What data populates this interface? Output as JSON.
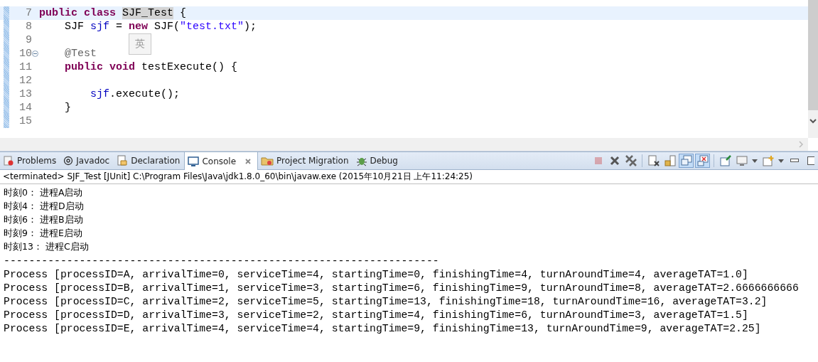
{
  "editor": {
    "lines": [
      {
        "number": "7",
        "current": true,
        "folding": false,
        "tokens": [
          {
            "kind": "keyword",
            "text": "public "
          },
          {
            "kind": "keyword",
            "text": "class "
          },
          {
            "kind": "occurrence",
            "text": "SJF_Test"
          },
          {
            "kind": "plain",
            "text": " {"
          }
        ]
      },
      {
        "number": "8",
        "current": false,
        "folding": false,
        "tokens": [
          {
            "kind": "plain",
            "text": "    SJF "
          },
          {
            "kind": "field",
            "text": "sjf"
          },
          {
            "kind": "plain",
            "text": " = "
          },
          {
            "kind": "keyword",
            "text": "new"
          },
          {
            "kind": "plain",
            "text": " SJF("
          },
          {
            "kind": "string",
            "text": "\"test.txt\""
          },
          {
            "kind": "plain",
            "text": ");"
          }
        ]
      },
      {
        "number": "9",
        "current": false,
        "folding": false
      },
      {
        "number": "10",
        "current": false,
        "folding": true,
        "tokens": [
          {
            "kind": "annotation",
            "text": "    @Test"
          }
        ]
      },
      {
        "number": "11",
        "current": false,
        "folding": false,
        "tokens": [
          {
            "kind": "keyword",
            "text": "    public "
          },
          {
            "kind": "keyword",
            "text": "void "
          },
          {
            "kind": "plain",
            "text": "testExecute() {"
          }
        ]
      },
      {
        "number": "12",
        "current": false,
        "folding": false
      },
      {
        "number": "13",
        "current": false,
        "folding": false,
        "tokens": [
          {
            "kind": "field",
            "text": "        sjf"
          },
          {
            "kind": "plain",
            "text": ".execute();"
          }
        ]
      },
      {
        "number": "14",
        "current": false,
        "folding": false,
        "tokens": [
          {
            "kind": "plain",
            "text": "    }"
          }
        ]
      },
      {
        "number": "15",
        "current": false,
        "folding": false
      }
    ],
    "ime_indicator": "英"
  },
  "tabs": [
    {
      "label": "Problems",
      "selected": false,
      "closable": false
    },
    {
      "label": "Javadoc",
      "selected": false,
      "closable": false
    },
    {
      "label": "Declaration",
      "selected": false,
      "closable": false
    },
    {
      "label": "Console",
      "selected": true,
      "closable": true
    },
    {
      "label": "Project Migration",
      "selected": false,
      "closable": false
    },
    {
      "label": "Debug",
      "selected": false,
      "closable": false
    }
  ],
  "toolbar": [
    {
      "kind": "terminate",
      "pressed": false,
      "disabled": true
    },
    {
      "kind": "remove",
      "pressed": false,
      "disabled": false
    },
    {
      "kind": "remove-all",
      "pressed": false,
      "disabled": false
    },
    {
      "kind": "separator"
    },
    {
      "kind": "clear",
      "pressed": false,
      "disabled": false
    },
    {
      "kind": "scroll-lock",
      "pressed": false,
      "disabled": false
    },
    {
      "kind": "show-out",
      "pressed": true,
      "disabled": false
    },
    {
      "kind": "show-err",
      "pressed": true,
      "disabled": false
    },
    {
      "kind": "separator"
    },
    {
      "kind": "pin",
      "pressed": false,
      "disabled": false
    },
    {
      "kind": "display",
      "pressed": false,
      "disabled": false
    },
    {
      "kind": "dropdown",
      "pressed": false,
      "disabled": false
    },
    {
      "kind": "open-console",
      "pressed": false,
      "disabled": false
    },
    {
      "kind": "dropdown",
      "pressed": false,
      "disabled": false
    },
    {
      "kind": "minimize",
      "pressed": false,
      "disabled": false
    },
    {
      "kind": "maximize",
      "pressed": false,
      "disabled": false
    }
  ],
  "console": {
    "header": "<terminated> SJF_Test [JUnit] C:\\Program Files\\Java\\jdk1.8.0_60\\bin\\javaw.exe (2015年10月21日 上午11:24:25)",
    "lines": [
      {
        "kind": "cjk",
        "text": "时刻0： 进程A启动"
      },
      {
        "kind": "cjk",
        "text": "时刻4： 进程D启动"
      },
      {
        "kind": "cjk",
        "text": "时刻6： 进程B启动"
      },
      {
        "kind": "cjk",
        "text": "时刻9： 进程E启动"
      },
      {
        "kind": "cjk",
        "text": "时刻13： 进程C启动"
      },
      {
        "kind": "mono",
        "text": "---------------------------------------------------------------------"
      },
      {
        "kind": "mono",
        "text": "Process [processID=A, arrivalTime=0, serviceTime=4, startingTime=0, finishingTime=4, turnAroundTime=4, averageTAT=1.0]"
      },
      {
        "kind": "mono",
        "text": "Process [processID=B, arrivalTime=1, serviceTime=3, startingTime=6, finishingTime=9, turnAroundTime=8, averageTAT=2.6666666666"
      },
      {
        "kind": "mono",
        "text": "Process [processID=C, arrivalTime=2, serviceTime=5, startingTime=13, finishingTime=18, turnAroundTime=16, averageTAT=3.2]"
      },
      {
        "kind": "mono",
        "text": "Process [processID=D, arrivalTime=3, serviceTime=2, startingTime=4, finishingTime=6, turnAroundTime=3, averageTAT=1.5]"
      },
      {
        "kind": "mono",
        "text": "Process [processID=E, arrivalTime=4, serviceTime=4, startingTime=9, finishingTime=13, turnAroundTime=9, averageTAT=2.25]"
      }
    ]
  }
}
